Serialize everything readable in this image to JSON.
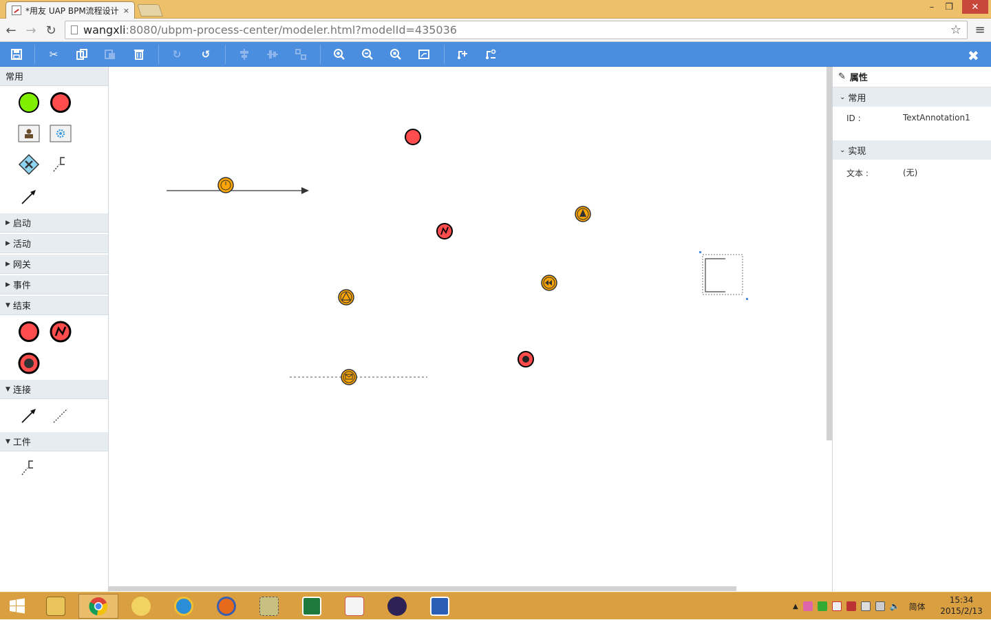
{
  "browser": {
    "tab_title": "*用友 UAP BPM流程设计",
    "tab_close": "×",
    "url_host": "wangxli",
    "url_rest": ":8080/ubpm-process-center/modeler.html?modelId=435036",
    "window_controls": {
      "minimize": "–",
      "maximize": "❐",
      "close": "✕"
    }
  },
  "toolbar": {
    "buttons": [
      "save-icon",
      "cut-icon",
      "copy-icon",
      "paste-icon",
      "delete-icon",
      "redo-icon",
      "undo-icon",
      "align-horizontal-icon",
      "align-vertical-icon",
      "group-icon",
      "zoom-in-icon",
      "zoom-out-icon",
      "zoom-fit-icon",
      "fullscreen-icon",
      "morph-icon",
      "connector-icon"
    ],
    "close_label": "✖",
    "accent": "#4b8ee0"
  },
  "palette": {
    "sections": {
      "common": "常用",
      "start": "启动",
      "activity": "活动",
      "gateway": "网关",
      "event": "事件",
      "end": "结束",
      "connect": "连接",
      "artifact": "工件"
    }
  },
  "properties": {
    "title": "属性",
    "section_common": "常用",
    "id_label": "ID :",
    "id_value": "TextAnnotation1",
    "section_impl": "实现",
    "text_label": "文本 :",
    "text_value": "(无)"
  },
  "taskbar": {
    "apps": [
      "windows-start-icon",
      "file-explorer-icon",
      "chrome-icon",
      "outlook-icon",
      "ie-icon",
      "firefox-icon",
      "tools-icon",
      "excel-icon",
      "java-icon",
      "eclipse-icon",
      "word-icon"
    ],
    "tray_lang": "简体",
    "time": "15:34",
    "date": "2015/2/13"
  },
  "colors": {
    "end_red": "#ff4d4d",
    "start_green": "#80ee00",
    "event_orange": "#ffa500"
  }
}
